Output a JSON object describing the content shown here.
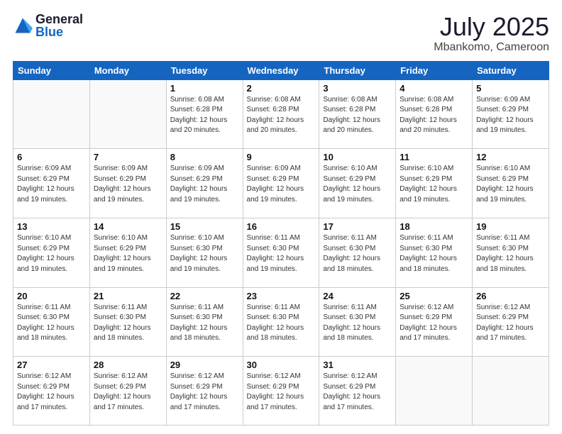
{
  "logo": {
    "general": "General",
    "blue": "Blue"
  },
  "header": {
    "month": "July 2025",
    "location": "Mbankomo, Cameroon"
  },
  "weekdays": [
    "Sunday",
    "Monday",
    "Tuesday",
    "Wednesday",
    "Thursday",
    "Friday",
    "Saturday"
  ],
  "weeks": [
    [
      {
        "day": "",
        "info": ""
      },
      {
        "day": "",
        "info": ""
      },
      {
        "day": "1",
        "info": "Sunrise: 6:08 AM\nSunset: 6:28 PM\nDaylight: 12 hours and 20 minutes."
      },
      {
        "day": "2",
        "info": "Sunrise: 6:08 AM\nSunset: 6:28 PM\nDaylight: 12 hours and 20 minutes."
      },
      {
        "day": "3",
        "info": "Sunrise: 6:08 AM\nSunset: 6:28 PM\nDaylight: 12 hours and 20 minutes."
      },
      {
        "day": "4",
        "info": "Sunrise: 6:08 AM\nSunset: 6:28 PM\nDaylight: 12 hours and 20 minutes."
      },
      {
        "day": "5",
        "info": "Sunrise: 6:09 AM\nSunset: 6:29 PM\nDaylight: 12 hours and 19 minutes."
      }
    ],
    [
      {
        "day": "6",
        "info": "Sunrise: 6:09 AM\nSunset: 6:29 PM\nDaylight: 12 hours and 19 minutes."
      },
      {
        "day": "7",
        "info": "Sunrise: 6:09 AM\nSunset: 6:29 PM\nDaylight: 12 hours and 19 minutes."
      },
      {
        "day": "8",
        "info": "Sunrise: 6:09 AM\nSunset: 6:29 PM\nDaylight: 12 hours and 19 minutes."
      },
      {
        "day": "9",
        "info": "Sunrise: 6:09 AM\nSunset: 6:29 PM\nDaylight: 12 hours and 19 minutes."
      },
      {
        "day": "10",
        "info": "Sunrise: 6:10 AM\nSunset: 6:29 PM\nDaylight: 12 hours and 19 minutes."
      },
      {
        "day": "11",
        "info": "Sunrise: 6:10 AM\nSunset: 6:29 PM\nDaylight: 12 hours and 19 minutes."
      },
      {
        "day": "12",
        "info": "Sunrise: 6:10 AM\nSunset: 6:29 PM\nDaylight: 12 hours and 19 minutes."
      }
    ],
    [
      {
        "day": "13",
        "info": "Sunrise: 6:10 AM\nSunset: 6:29 PM\nDaylight: 12 hours and 19 minutes."
      },
      {
        "day": "14",
        "info": "Sunrise: 6:10 AM\nSunset: 6:29 PM\nDaylight: 12 hours and 19 minutes."
      },
      {
        "day": "15",
        "info": "Sunrise: 6:10 AM\nSunset: 6:30 PM\nDaylight: 12 hours and 19 minutes."
      },
      {
        "day": "16",
        "info": "Sunrise: 6:11 AM\nSunset: 6:30 PM\nDaylight: 12 hours and 19 minutes."
      },
      {
        "day": "17",
        "info": "Sunrise: 6:11 AM\nSunset: 6:30 PM\nDaylight: 12 hours and 18 minutes."
      },
      {
        "day": "18",
        "info": "Sunrise: 6:11 AM\nSunset: 6:30 PM\nDaylight: 12 hours and 18 minutes."
      },
      {
        "day": "19",
        "info": "Sunrise: 6:11 AM\nSunset: 6:30 PM\nDaylight: 12 hours and 18 minutes."
      }
    ],
    [
      {
        "day": "20",
        "info": "Sunrise: 6:11 AM\nSunset: 6:30 PM\nDaylight: 12 hours and 18 minutes."
      },
      {
        "day": "21",
        "info": "Sunrise: 6:11 AM\nSunset: 6:30 PM\nDaylight: 12 hours and 18 minutes."
      },
      {
        "day": "22",
        "info": "Sunrise: 6:11 AM\nSunset: 6:30 PM\nDaylight: 12 hours and 18 minutes."
      },
      {
        "day": "23",
        "info": "Sunrise: 6:11 AM\nSunset: 6:30 PM\nDaylight: 12 hours and 18 minutes."
      },
      {
        "day": "24",
        "info": "Sunrise: 6:11 AM\nSunset: 6:30 PM\nDaylight: 12 hours and 18 minutes."
      },
      {
        "day": "25",
        "info": "Sunrise: 6:12 AM\nSunset: 6:29 PM\nDaylight: 12 hours and 17 minutes."
      },
      {
        "day": "26",
        "info": "Sunrise: 6:12 AM\nSunset: 6:29 PM\nDaylight: 12 hours and 17 minutes."
      }
    ],
    [
      {
        "day": "27",
        "info": "Sunrise: 6:12 AM\nSunset: 6:29 PM\nDaylight: 12 hours and 17 minutes."
      },
      {
        "day": "28",
        "info": "Sunrise: 6:12 AM\nSunset: 6:29 PM\nDaylight: 12 hours and 17 minutes."
      },
      {
        "day": "29",
        "info": "Sunrise: 6:12 AM\nSunset: 6:29 PM\nDaylight: 12 hours and 17 minutes."
      },
      {
        "day": "30",
        "info": "Sunrise: 6:12 AM\nSunset: 6:29 PM\nDaylight: 12 hours and 17 minutes."
      },
      {
        "day": "31",
        "info": "Sunrise: 6:12 AM\nSunset: 6:29 PM\nDaylight: 12 hours and 17 minutes."
      },
      {
        "day": "",
        "info": ""
      },
      {
        "day": "",
        "info": ""
      }
    ]
  ]
}
